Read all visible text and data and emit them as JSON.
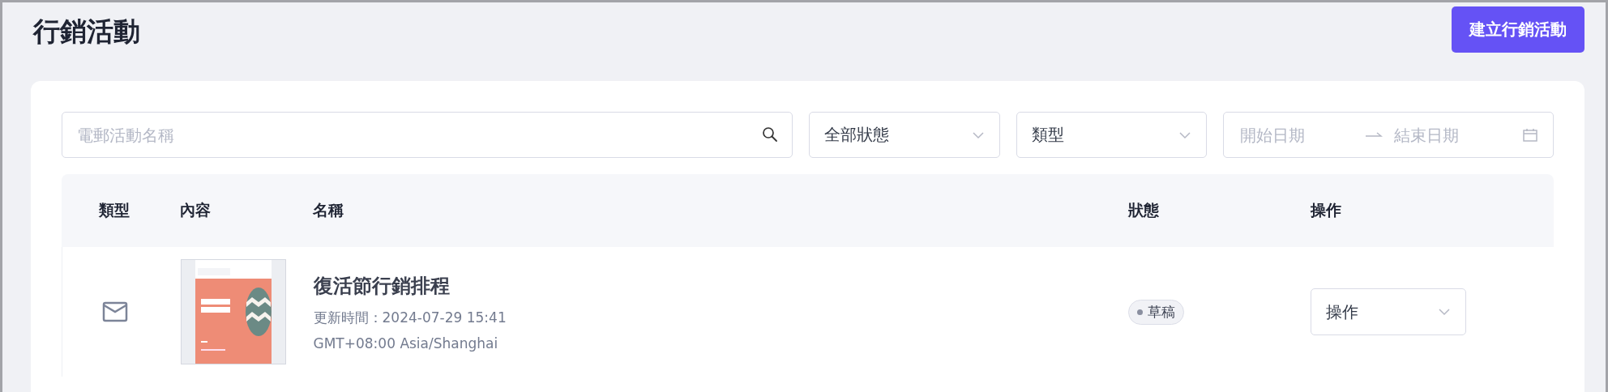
{
  "page_title": "行銷活動",
  "create_button": "建立行銷活動",
  "filters": {
    "search": {
      "placeholder": "電郵活動名稱"
    },
    "status": {
      "value": "全部狀態"
    },
    "type": {
      "value": "類型"
    },
    "date_range": {
      "start_placeholder": "開始日期",
      "end_placeholder": "結束日期"
    }
  },
  "table": {
    "columns": [
      "類型",
      "內容",
      "名稱",
      "狀態",
      "操作"
    ],
    "rows": [
      {
        "kind": "email",
        "name": "復活節行銷排程",
        "updated": "更新時間：2024-07-29 15:41",
        "timezone": "GMT+08:00 Asia/Shanghai",
        "status": "草稿",
        "action": "操作"
      }
    ]
  }
}
